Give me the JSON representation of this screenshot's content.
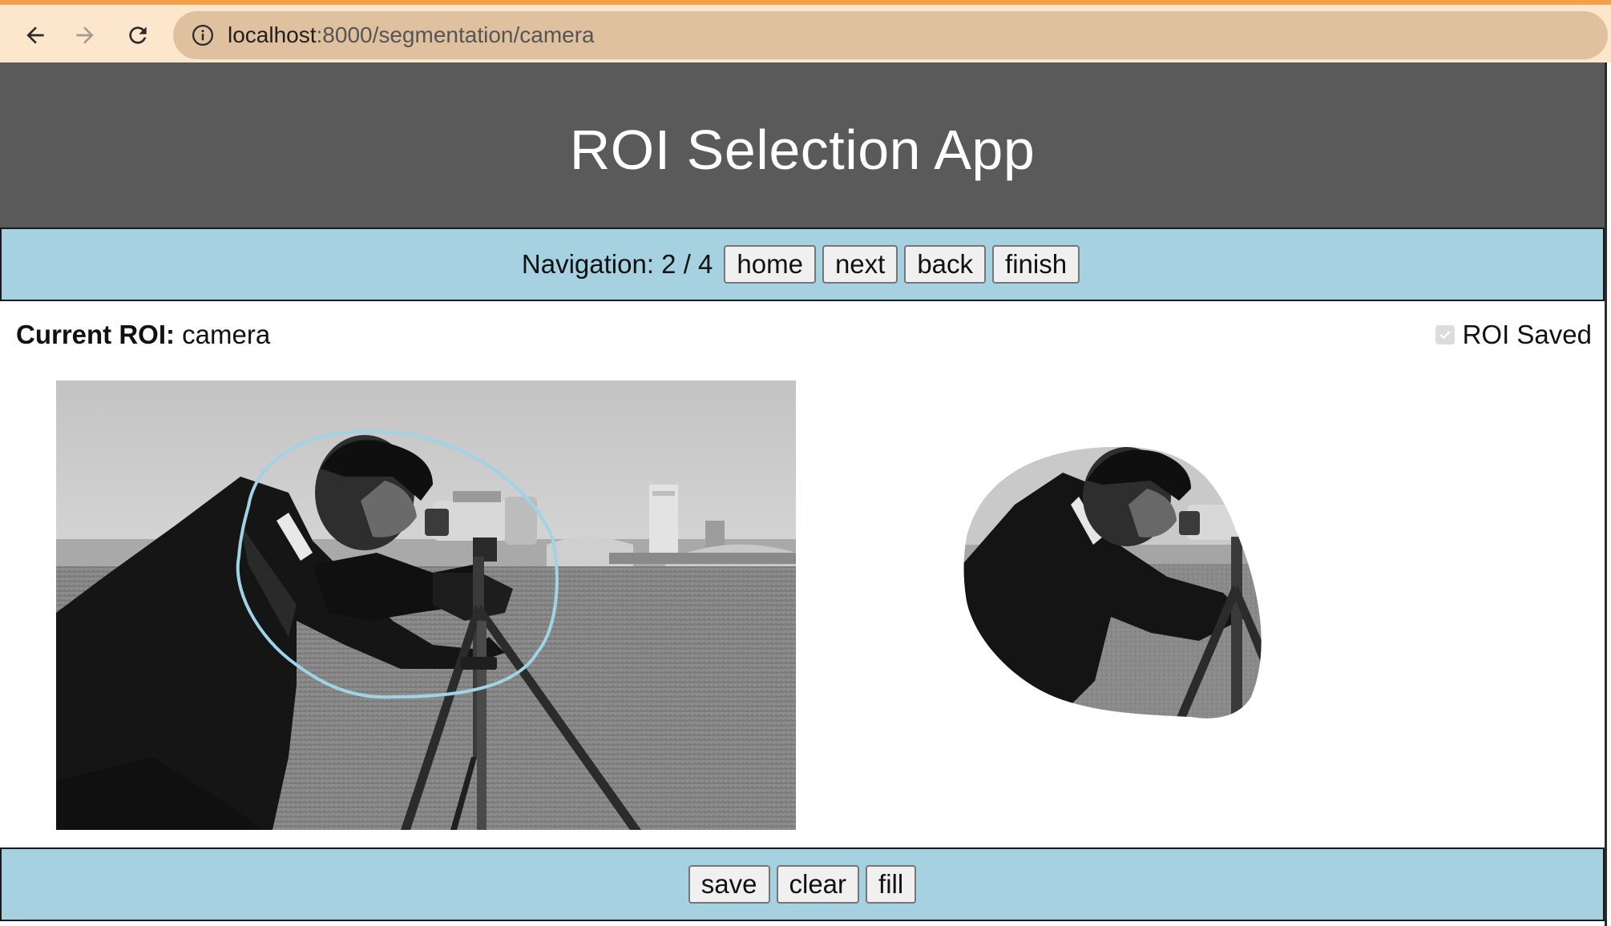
{
  "browser": {
    "url_host": "localhost",
    "url_path": ":8000/segmentation/camera",
    "back_icon": "arrow-left-icon",
    "forward_icon": "arrow-right-icon",
    "reload_icon": "reload-icon",
    "info_icon": "info-icon"
  },
  "header": {
    "title": "ROI Selection App"
  },
  "navigation": {
    "label": "Navigation: 2 / 4",
    "buttons": {
      "home": "home",
      "next": "next",
      "back": "back",
      "finish": "finish"
    }
  },
  "roi": {
    "current_label": "Current ROI:",
    "current_value": "camera",
    "saved_label": "ROI Saved",
    "saved_checked": true
  },
  "actions": {
    "save": "save",
    "clear": "clear",
    "fill": "fill"
  },
  "colors": {
    "accent_strip": "#f5a04a",
    "chrome_bg": "#fce6cc",
    "omnibox_bg": "#e0c19f",
    "header_bg": "#5a5a5a",
    "bar_bg": "#a6d1e1",
    "roi_outline": "#9fd3e6",
    "inactive_icon": "#a59a8d",
    "active_icon": "#2a2a2a"
  }
}
